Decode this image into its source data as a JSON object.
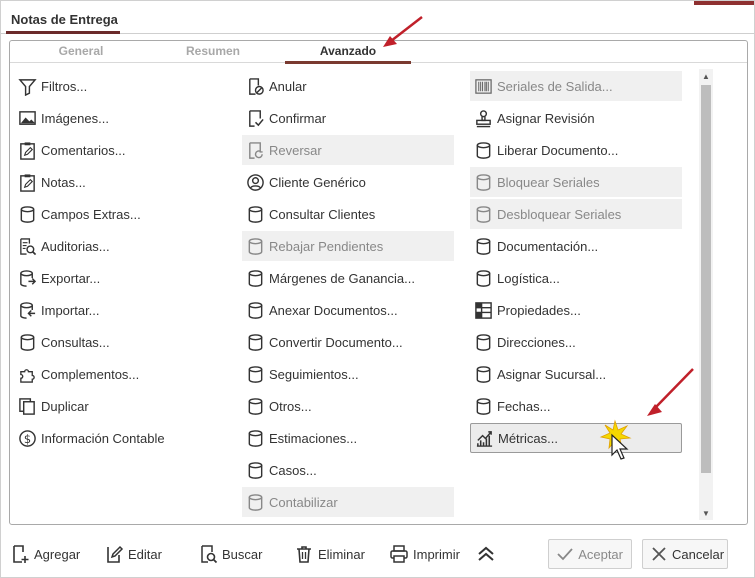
{
  "window": {
    "title": "Notas de Entrega"
  },
  "tabs": [
    {
      "label": "General"
    },
    {
      "label": "Resumen"
    },
    {
      "label": "Avanzado"
    }
  ],
  "columns": [
    [
      {
        "label": "Filtros...",
        "icon": "filter-icon",
        "disabled": false
      },
      {
        "label": "Imágenes...",
        "icon": "image-icon",
        "disabled": false
      },
      {
        "label": "Comentarios...",
        "icon": "clipboard-edit-icon",
        "disabled": false
      },
      {
        "label": "Notas...",
        "icon": "clipboard-edit-icon",
        "disabled": false
      },
      {
        "label": "Campos Extras...",
        "icon": "database-icon",
        "disabled": false
      },
      {
        "label": "Auditorias...",
        "icon": "audit-search-icon",
        "disabled": false
      },
      {
        "label": "Exportar...",
        "icon": "database-export-icon",
        "disabled": false
      },
      {
        "label": "Importar...",
        "icon": "database-import-icon",
        "disabled": false
      },
      {
        "label": "Consultas...",
        "icon": "database-icon",
        "disabled": false
      },
      {
        "label": "Complementos...",
        "icon": "puzzle-icon",
        "disabled": false
      },
      {
        "label": "Duplicar",
        "icon": "copy-icon",
        "disabled": false
      },
      {
        "label": "Información Contable",
        "icon": "dollar-circle-icon",
        "disabled": false
      }
    ],
    [
      {
        "label": "Anular",
        "icon": "document-cancel-icon",
        "disabled": false
      },
      {
        "label": "Confirmar",
        "icon": "document-check-icon",
        "disabled": false
      },
      {
        "label": "Reversar",
        "icon": "document-undo-icon",
        "disabled": true
      },
      {
        "label": "Cliente Genérico",
        "icon": "user-circle-icon",
        "disabled": false
      },
      {
        "label": "Consultar Clientes",
        "icon": "database-icon",
        "disabled": false
      },
      {
        "label": "Rebajar Pendientes",
        "icon": "database-icon",
        "disabled": true
      },
      {
        "label": "Márgenes de Ganancia...",
        "icon": "database-icon",
        "disabled": false
      },
      {
        "label": "Anexar Documentos...",
        "icon": "database-icon",
        "disabled": false
      },
      {
        "label": "Convertir Documento...",
        "icon": "database-icon",
        "disabled": false
      },
      {
        "label": "Seguimientos...",
        "icon": "database-icon",
        "disabled": false
      },
      {
        "label": "Otros...",
        "icon": "database-icon",
        "disabled": false
      },
      {
        "label": "Estimaciones...",
        "icon": "database-icon",
        "disabled": false
      },
      {
        "label": "Casos...",
        "icon": "database-icon",
        "disabled": false
      },
      {
        "label": "Contabilizar",
        "icon": "database-icon",
        "disabled": true
      }
    ],
    [
      {
        "label": "Seriales de Salida...",
        "icon": "barcode-icon",
        "disabled": true
      },
      {
        "label": "Asignar Revisión",
        "icon": "stamp-icon",
        "disabled": false
      },
      {
        "label": "Liberar Documento...",
        "icon": "database-icon",
        "disabled": false
      },
      {
        "label": "Bloquear Seriales",
        "icon": "database-icon",
        "disabled": true
      },
      {
        "label": "Desbloquear Seriales",
        "icon": "database-icon",
        "disabled": true
      },
      {
        "label": "Documentación...",
        "icon": "database-icon",
        "disabled": false
      },
      {
        "label": "Logística...",
        "icon": "database-icon",
        "disabled": false
      },
      {
        "label": "Propiedades...",
        "icon": "properties-grid-icon",
        "disabled": false
      },
      {
        "label": "Direcciones...",
        "icon": "database-icon",
        "disabled": false
      },
      {
        "label": "Asignar Sucursal...",
        "icon": "database-icon",
        "disabled": false
      },
      {
        "label": "Fechas...",
        "icon": "database-icon",
        "disabled": false
      },
      {
        "label": "Métricas...",
        "icon": "trending-chart-icon",
        "disabled": false,
        "highlighted": true
      }
    ]
  ],
  "toolbar": {
    "add": "Agregar",
    "edit": "Editar",
    "search": "Buscar",
    "delete": "Eliminar",
    "print": "Imprimir",
    "accept": "Aceptar",
    "cancel": "Cancelar"
  },
  "colors": {
    "accent": "#7a3a30",
    "annotation_arrow": "#c0202a",
    "disabled_bg": "#f0f0f0"
  }
}
